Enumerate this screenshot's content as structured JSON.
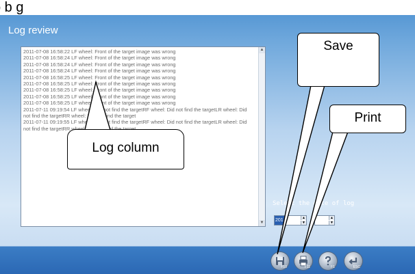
{
  "header_fragment": "b  b g",
  "title": "Log review",
  "log": {
    "lines": [
      "2011-07-08 16:58:22 LF wheel: Front of the target image was wrong",
      "2011-07-08 16:58:24 LF wheel: Front of the target image was wrong",
      "2011-07-08 16:58:24 LF wheel: Front of the target image was wrong",
      "2011-07-08 16:58:24 LF wheel: Front of the target image was wrong",
      "2011-07-08 16:58:25 LF wheel: Front of the target image was wrong",
      "2011-07-08 16:58:25 LF wheel: Front of the target image was wrong",
      "2011-07-08 16:58:25 LF wheel: Front of the target image was wrong",
      "2011-07-08 16:58:25 LF wheel: Front of the target image was wrong",
      "2011-07-08 16:58:25 LF wheel: Front of the target image was wrong"
    ],
    "wrapped": [
      "2011-07-11 09:19:54 LF wheel: Did not find the targetRF wheel: Did not find the targetLR wheel: Did not find the targetRR wheel: Did not find the target",
      "2011-07-11 09:19:55 LF wheel: Did not find the targetRF wheel: Did not find the targetLR wheel: Did not find the targetRR wheel: Did not find the target"
    ]
  },
  "date_select": {
    "label": "Select the date of log",
    "year_value": "201",
    "month_value": ""
  },
  "buttons": {
    "save_key": "F10",
    "print_key": "F11",
    "help_key": "F1",
    "back_key": "ESC"
  },
  "callouts": {
    "log_column": "Log column",
    "save": "Save",
    "print": "Print"
  },
  "colors": {
    "background_top": "#4a8fd0",
    "background_bottom": "#2f6fbd",
    "callout_border": "#000000"
  }
}
